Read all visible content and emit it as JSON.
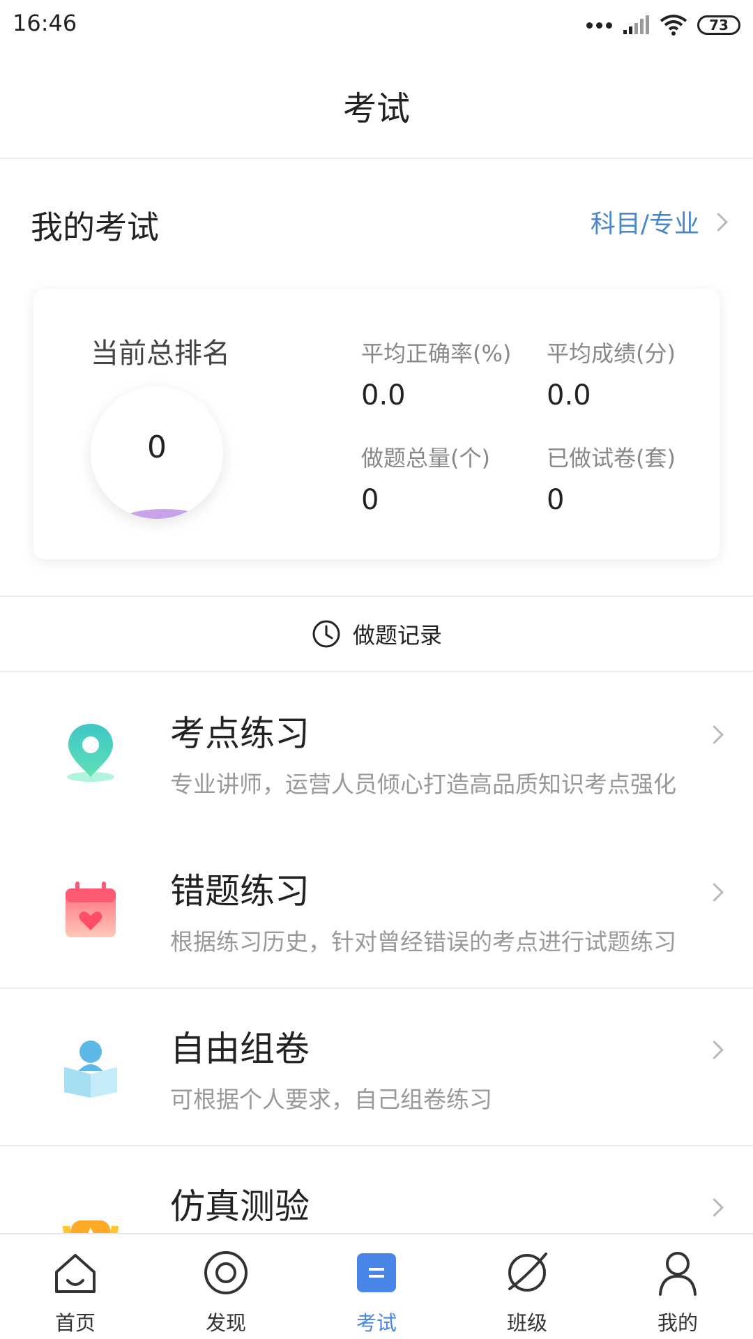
{
  "status_bar": {
    "time": "16:46",
    "battery": "73"
  },
  "header": {
    "title": "考试"
  },
  "my_exam": {
    "title": "我的考试",
    "subject_link": "科目/专业"
  },
  "stats": {
    "rank_label": "当前总排名",
    "rank_value": "0",
    "items": [
      {
        "label": "平均正确率(%)",
        "value": "0.0"
      },
      {
        "label": "平均成绩(分)",
        "value": "0.0"
      },
      {
        "label": "做题总量(个)",
        "value": "0"
      },
      {
        "label": "已做试卷(套)",
        "value": "0"
      }
    ]
  },
  "record": {
    "label": "做题记录"
  },
  "menu": [
    {
      "title": "考点练习",
      "desc": "专业讲师，运营人员倾心打造高品质知识考点强化",
      "icon": "location-pin-icon"
    },
    {
      "title": "错题练习",
      "desc": "根据练习历史，针对曾经错误的考点进行试题练习",
      "icon": "calendar-heart-icon"
    },
    {
      "title": "自由组卷",
      "desc": "可根据个人要求，自己组卷练习",
      "icon": "reader-book-icon"
    },
    {
      "title": "仿真测验",
      "desc": "",
      "icon": "trophy-icon"
    }
  ],
  "tabs": [
    {
      "label": "首页",
      "icon": "home-icon"
    },
    {
      "label": "发现",
      "icon": "discover-icon"
    },
    {
      "label": "考试",
      "icon": "exam-icon",
      "active": true
    },
    {
      "label": "班级",
      "icon": "planet-icon"
    },
    {
      "label": "我的",
      "icon": "person-icon"
    }
  ],
  "colors": {
    "accent": "#4a86e8",
    "link": "#4a86c8"
  }
}
